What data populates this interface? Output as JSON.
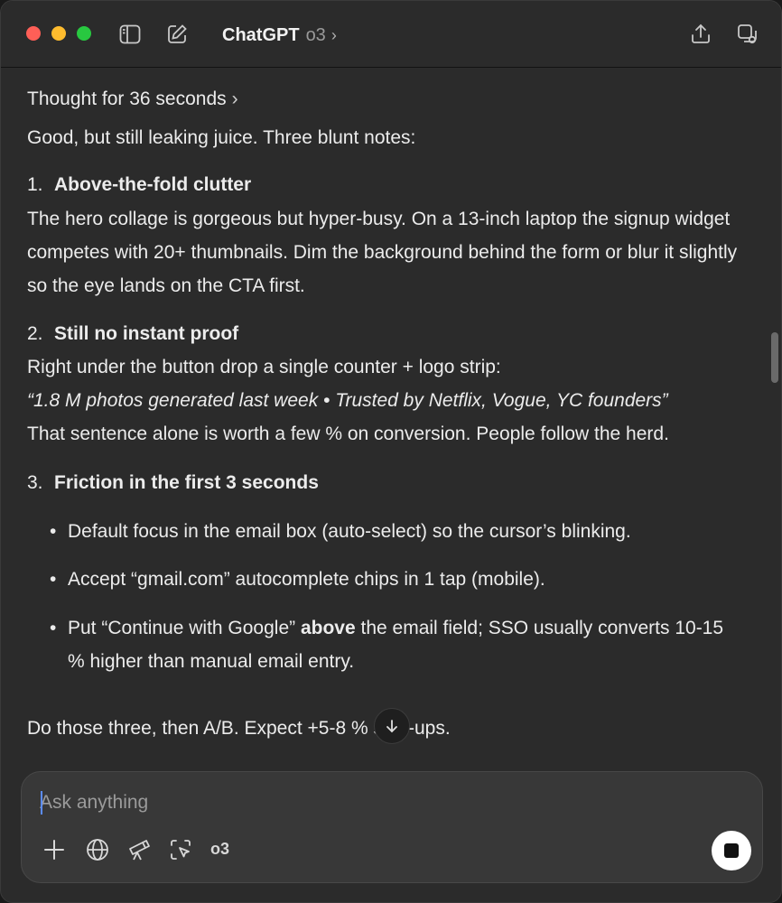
{
  "titlebar": {
    "app_name": "ChatGPT",
    "model_version": "o3",
    "chevron": "›"
  },
  "message": {
    "thought_label": "Thought for 36 seconds",
    "thought_chevron": "›",
    "intro": "Good, but still leaking juice. Three blunt notes:",
    "items": [
      {
        "number": "1.",
        "heading": "Above-the-fold clutter",
        "body": "The hero collage is gorgeous but hyper-busy. On a 13-inch laptop the signup widget competes with 20+ thumbnails. Dim the background behind the form or blur it slightly so the eye lands on the CTA first."
      },
      {
        "number": "2.",
        "heading": "Still no instant proof",
        "body_line1": "Right under the button drop a single counter + logo strip:",
        "quote": "“1.8 M photos generated last week • Trusted by Netflix, Vogue, YC founders”",
        "body_line3": "That sentence alone is worth a few % on conversion. People follow the herd."
      },
      {
        "number": "3.",
        "heading": "Friction in the first 3 seconds",
        "bullets": [
          "Default focus in the email box (auto-select) so the cursor’s blinking.",
          "Accept “gmail.com” autocomplete chips in 1 tap (mobile)."
        ],
        "bullet3_pre": "Put “Continue with Google” ",
        "bullet3_bold": "above",
        "bullet3_post": " the email field; SSO usually converts 10-15 % higher than manual email entry."
      }
    ],
    "bullet_char": "•",
    "final": "Do those three, then A/B. Expect +5-8 % sign-ups."
  },
  "composer": {
    "placeholder": "Ask anything",
    "model_chip": "o3"
  },
  "icons": {
    "sidebar": "sidebar-toggle-icon",
    "compose": "new-chat-icon",
    "share": "share-icon",
    "new_window": "new-window-icon",
    "jump": "arrow-down-icon",
    "plus": "plus-icon",
    "globe": "globe-icon",
    "telescope": "telescope-icon",
    "select": "screen-select-icon",
    "stop": "stop-icon"
  }
}
